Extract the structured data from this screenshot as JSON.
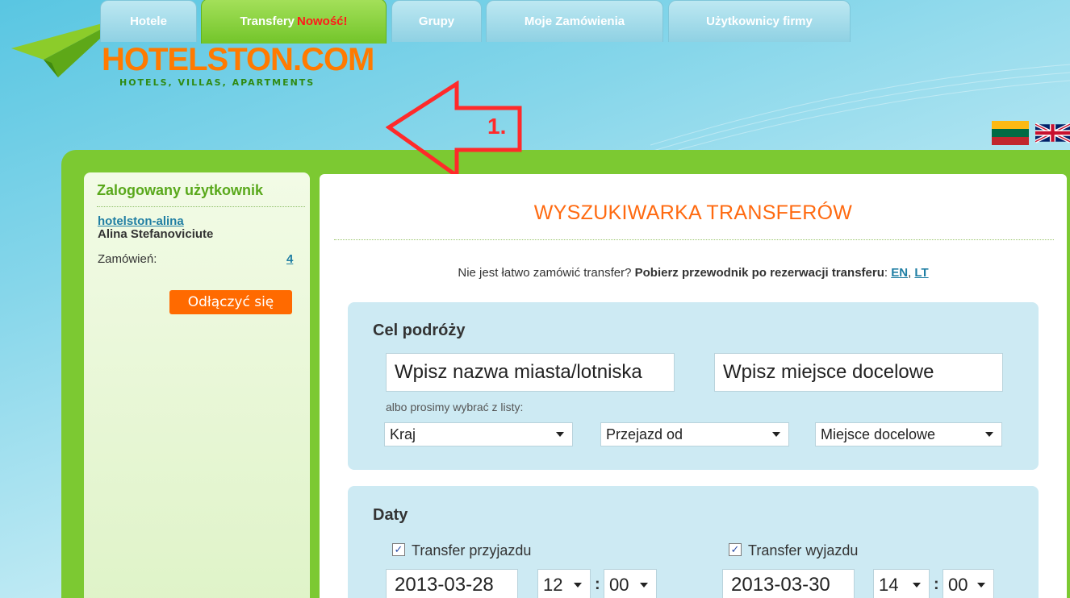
{
  "logo": {
    "title": "HOTELSTON.COM",
    "subtitle": "HOTELS, VILLAS, APARTMENTS"
  },
  "tabs": [
    {
      "label": "Hotele"
    },
    {
      "label": "Transfery",
      "badge": "Nowość!"
    },
    {
      "label": "Grupy"
    },
    {
      "label": "Moje Zamówienia"
    },
    {
      "label": "Użytkownicy firmy"
    }
  ],
  "annotation": {
    "step": "1."
  },
  "sidebar": {
    "title": "Zalogowany użytkownik",
    "username": "hotelston-alina",
    "fullname": "Alina Stefanoviciute",
    "orders_label": "Zamówień:",
    "orders_count": "4",
    "logout_label": "Odłączyć się"
  },
  "main": {
    "title": "WYSZUKIWARKA TRANSFERÓW",
    "guide_text": "Nie jest łatwo zamówić transfer?",
    "guide_bold": "Pobierz przewodnik po rezerwacji transferu",
    "guide_sep": ":",
    "guide_link_en": "EN",
    "guide_link_comma": ",",
    "guide_link_lt": "LT"
  },
  "destination": {
    "title": "Cel podróży",
    "from_input": "Wpisz nazwa miasta/lotniska",
    "to_input": "Wpisz miejsce docelowe",
    "hint": "albo prosimy wybrać z listy:",
    "select_country": "Kraj",
    "select_from": "Przejazd od",
    "select_to": "Miejsce docelowe"
  },
  "dates": {
    "title": "Daty",
    "arrival_label": "Transfer przyjazdu",
    "arrival_checked": "✓",
    "arrival_date": "2013-03-28",
    "arrival_hour": "12",
    "arrival_min": "00",
    "departure_label": "Transfer wyjazdu",
    "departure_checked": "✓",
    "departure_date": "2013-03-30",
    "departure_hour": "14",
    "departure_min": "00",
    "colon": ":"
  },
  "colors": {
    "brand_orange": "#ff6a00",
    "brand_green": "#7cc932",
    "link_blue": "#1f7ea3",
    "annotation_red": "#ff2a2a"
  }
}
